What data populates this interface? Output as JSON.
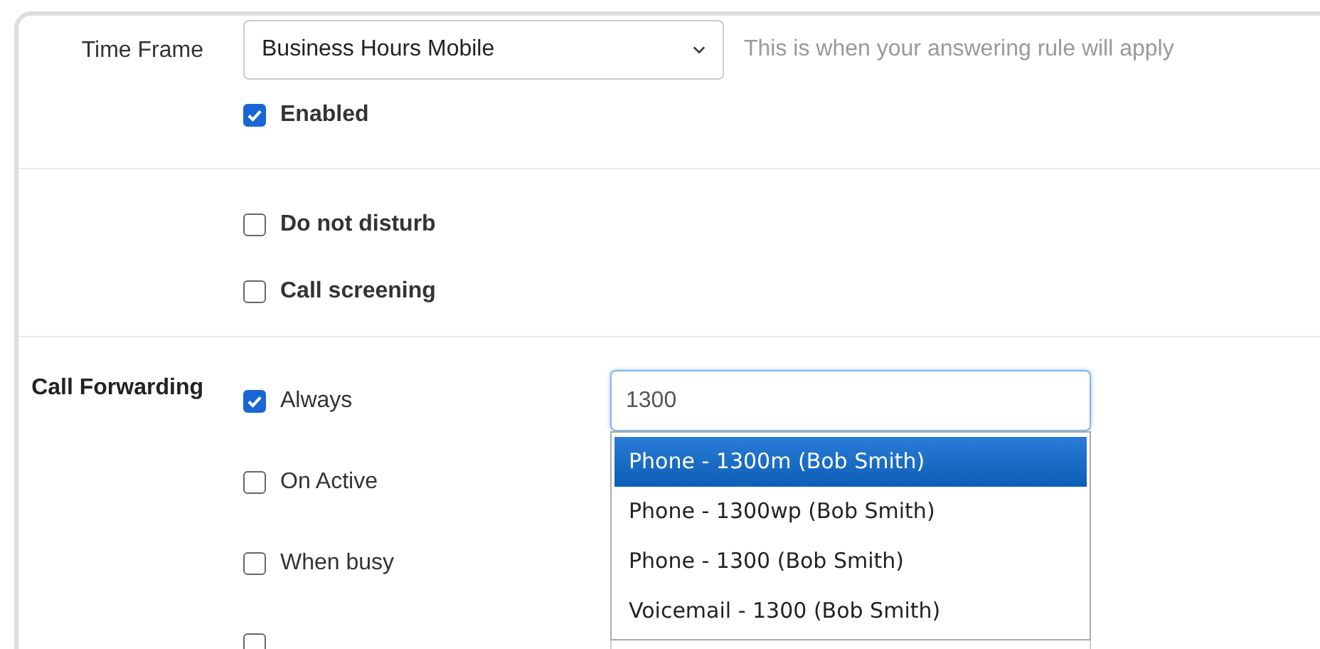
{
  "time_frame": {
    "label": "Time Frame",
    "value": "Business Hours Mobile",
    "hint": "This is when your answering rule will apply"
  },
  "enabled": {
    "label": "Enabled",
    "checked": true
  },
  "options": [
    {
      "label": "Do not disturb",
      "checked": false
    },
    {
      "label": "Call screening",
      "checked": false
    }
  ],
  "call_forwarding": {
    "label": "Call Forwarding",
    "rules": [
      {
        "label": "Always",
        "checked": true,
        "value": "1300"
      },
      {
        "label": "On Active",
        "checked": false
      },
      {
        "label": "When busy",
        "checked": false
      },
      {
        "checked": false
      }
    ]
  },
  "suggestions": [
    {
      "label": "Phone - 1300m (Bob Smith)",
      "selected": true
    },
    {
      "label": "Phone - 1300wp (Bob Smith)",
      "selected": false
    },
    {
      "label": "Phone - 1300 (Bob Smith)",
      "selected": false
    },
    {
      "label": "Voicemail - 1300 (Bob Smith)",
      "selected": false
    }
  ]
}
